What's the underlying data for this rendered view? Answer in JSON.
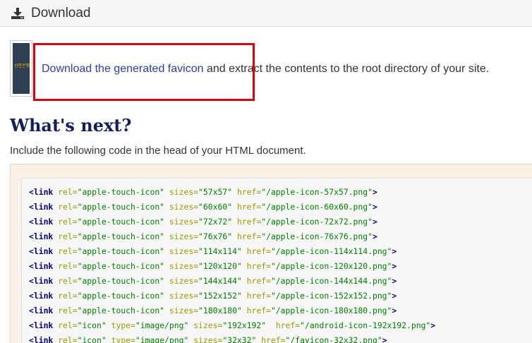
{
  "panel": {
    "title": "Download",
    "icon": "download-icon"
  },
  "thumbnail": {
    "text": "신한은행"
  },
  "download": {
    "link_label": "Download the generated favicon",
    "rest_text": " and extract the contents to the root directory of your site."
  },
  "whats_next": {
    "heading": "What's next?",
    "instruction": "Include the following code in the head of your HTML document."
  },
  "colors": {
    "highlight": "#e0000f",
    "link": "#2a3cb3",
    "heading": "#10205e",
    "code_tag": "#000080",
    "code_attr": "#9c9c00",
    "code_value": "#008000"
  },
  "code_lines": [
    [
      {
        "k": "t",
        "s": "<link"
      },
      {
        "k": "p",
        "s": " "
      },
      {
        "k": "a",
        "s": "rel="
      },
      {
        "k": "v",
        "s": "\"apple-touch-icon\""
      },
      {
        "k": "p",
        "s": " "
      },
      {
        "k": "a",
        "s": "sizes="
      },
      {
        "k": "v",
        "s": "\"57x57\""
      },
      {
        "k": "p",
        "s": " "
      },
      {
        "k": "a",
        "s": "href="
      },
      {
        "k": "v",
        "s": "\"/apple-icon-57x57.png\""
      },
      {
        "k": "t",
        "s": ">"
      }
    ],
    [
      {
        "k": "t",
        "s": "<link"
      },
      {
        "k": "p",
        "s": " "
      },
      {
        "k": "a",
        "s": "rel="
      },
      {
        "k": "v",
        "s": "\"apple-touch-icon\""
      },
      {
        "k": "p",
        "s": " "
      },
      {
        "k": "a",
        "s": "sizes="
      },
      {
        "k": "v",
        "s": "\"60x60\""
      },
      {
        "k": "p",
        "s": " "
      },
      {
        "k": "a",
        "s": "href="
      },
      {
        "k": "v",
        "s": "\"/apple-icon-60x60.png\""
      },
      {
        "k": "t",
        "s": ">"
      }
    ],
    [
      {
        "k": "t",
        "s": "<link"
      },
      {
        "k": "p",
        "s": " "
      },
      {
        "k": "a",
        "s": "rel="
      },
      {
        "k": "v",
        "s": "\"apple-touch-icon\""
      },
      {
        "k": "p",
        "s": " "
      },
      {
        "k": "a",
        "s": "sizes="
      },
      {
        "k": "v",
        "s": "\"72x72\""
      },
      {
        "k": "p",
        "s": " "
      },
      {
        "k": "a",
        "s": "href="
      },
      {
        "k": "v",
        "s": "\"/apple-icon-72x72.png\""
      },
      {
        "k": "t",
        "s": ">"
      }
    ],
    [
      {
        "k": "t",
        "s": "<link"
      },
      {
        "k": "p",
        "s": " "
      },
      {
        "k": "a",
        "s": "rel="
      },
      {
        "k": "v",
        "s": "\"apple-touch-icon\""
      },
      {
        "k": "p",
        "s": " "
      },
      {
        "k": "a",
        "s": "sizes="
      },
      {
        "k": "v",
        "s": "\"76x76\""
      },
      {
        "k": "p",
        "s": " "
      },
      {
        "k": "a",
        "s": "href="
      },
      {
        "k": "v",
        "s": "\"/apple-icon-76x76.png\""
      },
      {
        "k": "t",
        "s": ">"
      }
    ],
    [
      {
        "k": "t",
        "s": "<link"
      },
      {
        "k": "p",
        "s": " "
      },
      {
        "k": "a",
        "s": "rel="
      },
      {
        "k": "v",
        "s": "\"apple-touch-icon\""
      },
      {
        "k": "p",
        "s": " "
      },
      {
        "k": "a",
        "s": "sizes="
      },
      {
        "k": "v",
        "s": "\"114x114\""
      },
      {
        "k": "p",
        "s": " "
      },
      {
        "k": "a",
        "s": "href="
      },
      {
        "k": "v",
        "s": "\"/apple-icon-114x114.png\""
      },
      {
        "k": "t",
        "s": ">"
      }
    ],
    [
      {
        "k": "t",
        "s": "<link"
      },
      {
        "k": "p",
        "s": " "
      },
      {
        "k": "a",
        "s": "rel="
      },
      {
        "k": "v",
        "s": "\"apple-touch-icon\""
      },
      {
        "k": "p",
        "s": " "
      },
      {
        "k": "a",
        "s": "sizes="
      },
      {
        "k": "v",
        "s": "\"120x120\""
      },
      {
        "k": "p",
        "s": " "
      },
      {
        "k": "a",
        "s": "href="
      },
      {
        "k": "v",
        "s": "\"/apple-icon-120x120.png\""
      },
      {
        "k": "t",
        "s": ">"
      }
    ],
    [
      {
        "k": "t",
        "s": "<link"
      },
      {
        "k": "p",
        "s": " "
      },
      {
        "k": "a",
        "s": "rel="
      },
      {
        "k": "v",
        "s": "\"apple-touch-icon\""
      },
      {
        "k": "p",
        "s": " "
      },
      {
        "k": "a",
        "s": "sizes="
      },
      {
        "k": "v",
        "s": "\"144x144\""
      },
      {
        "k": "p",
        "s": " "
      },
      {
        "k": "a",
        "s": "href="
      },
      {
        "k": "v",
        "s": "\"/apple-icon-144x144.png\""
      },
      {
        "k": "t",
        "s": ">"
      }
    ],
    [
      {
        "k": "t",
        "s": "<link"
      },
      {
        "k": "p",
        "s": " "
      },
      {
        "k": "a",
        "s": "rel="
      },
      {
        "k": "v",
        "s": "\"apple-touch-icon\""
      },
      {
        "k": "p",
        "s": " "
      },
      {
        "k": "a",
        "s": "sizes="
      },
      {
        "k": "v",
        "s": "\"152x152\""
      },
      {
        "k": "p",
        "s": " "
      },
      {
        "k": "a",
        "s": "href="
      },
      {
        "k": "v",
        "s": "\"/apple-icon-152x152.png\""
      },
      {
        "k": "t",
        "s": ">"
      }
    ],
    [
      {
        "k": "t",
        "s": "<link"
      },
      {
        "k": "p",
        "s": " "
      },
      {
        "k": "a",
        "s": "rel="
      },
      {
        "k": "v",
        "s": "\"apple-touch-icon\""
      },
      {
        "k": "p",
        "s": " "
      },
      {
        "k": "a",
        "s": "sizes="
      },
      {
        "k": "v",
        "s": "\"180x180\""
      },
      {
        "k": "p",
        "s": " "
      },
      {
        "k": "a",
        "s": "href="
      },
      {
        "k": "v",
        "s": "\"/apple-icon-180x180.png\""
      },
      {
        "k": "t",
        "s": ">"
      }
    ],
    [
      {
        "k": "t",
        "s": "<link"
      },
      {
        "k": "p",
        "s": " "
      },
      {
        "k": "a",
        "s": "rel="
      },
      {
        "k": "v",
        "s": "\"icon\""
      },
      {
        "k": "p",
        "s": " "
      },
      {
        "k": "a",
        "s": "type="
      },
      {
        "k": "v",
        "s": "\"image/png\""
      },
      {
        "k": "p",
        "s": " "
      },
      {
        "k": "a",
        "s": "sizes="
      },
      {
        "k": "v",
        "s": "\"192x192\""
      },
      {
        "k": "p",
        "s": "  "
      },
      {
        "k": "a",
        "s": "href="
      },
      {
        "k": "v",
        "s": "\"/android-icon-192x192.png\""
      },
      {
        "k": "t",
        "s": ">"
      }
    ],
    [
      {
        "k": "t",
        "s": "<link"
      },
      {
        "k": "p",
        "s": " "
      },
      {
        "k": "a",
        "s": "rel="
      },
      {
        "k": "v",
        "s": "\"icon\""
      },
      {
        "k": "p",
        "s": " "
      },
      {
        "k": "a",
        "s": "type="
      },
      {
        "k": "v",
        "s": "\"image/png\""
      },
      {
        "k": "p",
        "s": " "
      },
      {
        "k": "a",
        "s": "sizes="
      },
      {
        "k": "v",
        "s": "\"32x32\""
      },
      {
        "k": "p",
        "s": " "
      },
      {
        "k": "a",
        "s": "href="
      },
      {
        "k": "v",
        "s": "\"/favicon-32x32.png\""
      },
      {
        "k": "t",
        "s": ">"
      }
    ]
  ]
}
